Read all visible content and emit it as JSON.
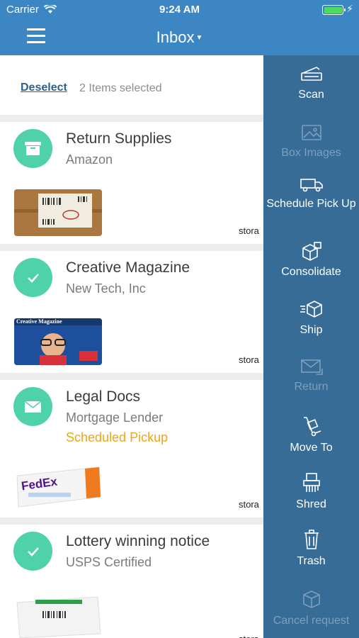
{
  "status_bar": {
    "carrier": "Carrier",
    "time": "9:24 AM"
  },
  "header": {
    "title": "Inbox"
  },
  "selection": {
    "deselect_label": "Deselect",
    "count_text": "2 Items selected"
  },
  "items": [
    {
      "title": "Return Supplies",
      "subtitle": "Amazon",
      "status": "",
      "selected": false,
      "storage_label": "stora"
    },
    {
      "title": "Creative Magazine",
      "subtitle": "New Tech, Inc",
      "status": "",
      "selected": true,
      "storage_label": "stora",
      "thumb_text": "Creative Magazine"
    },
    {
      "title": "Legal Docs",
      "subtitle": "Mortgage Lender",
      "status": "Scheduled Pickup",
      "selected": false,
      "storage_label": "stora",
      "thumb_text": "FedEx"
    },
    {
      "title": "Lottery winning notice",
      "subtitle": "USPS Certified",
      "status": "",
      "selected": true,
      "storage_label": "stora"
    }
  ],
  "actions": [
    {
      "label": "Scan",
      "icon": "scanner-icon",
      "enabled": true
    },
    {
      "label": "Box Images",
      "icon": "image-icon",
      "enabled": false
    },
    {
      "label": "Schedule Pick Up",
      "icon": "truck-icon",
      "enabled": true
    },
    {
      "label": "Consolidate",
      "icon": "boxes-icon",
      "enabled": true
    },
    {
      "label": "Ship",
      "icon": "shipping-box-icon",
      "enabled": true
    },
    {
      "label": "Return",
      "icon": "return-mail-icon",
      "enabled": false
    },
    {
      "label": "Move To",
      "icon": "hand-truck-icon",
      "enabled": true
    },
    {
      "label": "Shred",
      "icon": "shredder-icon",
      "enabled": true
    },
    {
      "label": "Trash",
      "icon": "trash-icon",
      "enabled": true
    },
    {
      "label": "Cancel request",
      "icon": "cancel-box-icon",
      "enabled": false
    }
  ],
  "colors": {
    "header": "#3c86c4",
    "panel": "#376c97",
    "accent_green": "#4fd1aa",
    "status_orange": "#f0a513",
    "link": "#2a5f8f"
  }
}
